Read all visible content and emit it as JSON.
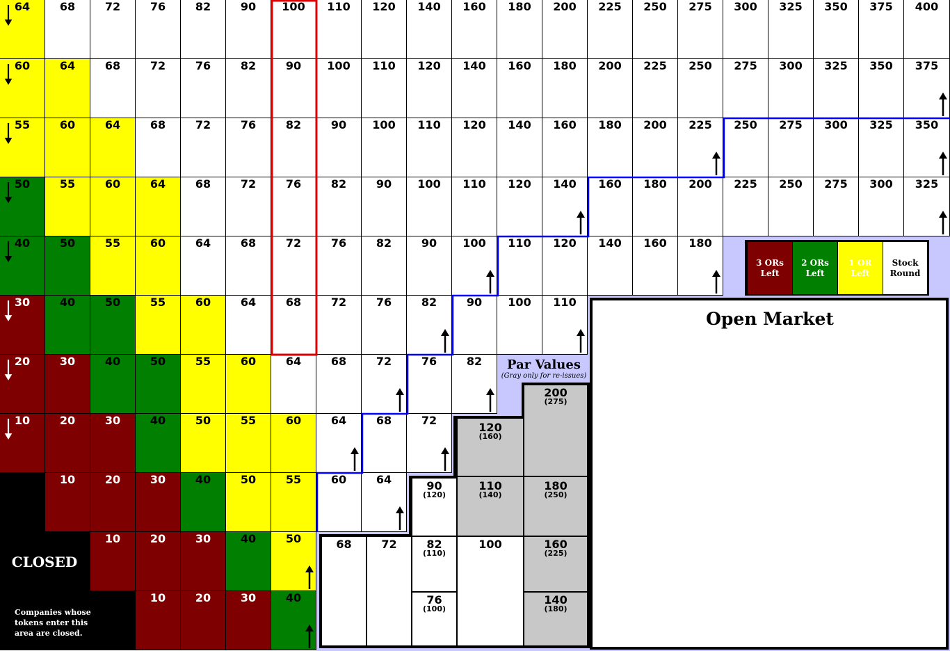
{
  "rows": [
    {
      "values": [
        "64",
        "68",
        "72",
        "76",
        "82",
        "90",
        "100",
        "110",
        "120",
        "140",
        "160",
        "180",
        "200",
        "225",
        "250",
        "275",
        "300",
        "325",
        "350",
        "375",
        "400"
      ],
      "colors": [
        "yellow",
        "white",
        "white",
        "white",
        "white",
        "white",
        "white",
        "white",
        "white",
        "white",
        "white",
        "white",
        "white",
        "white",
        "white",
        "white",
        "white",
        "white",
        "white",
        "white",
        "white"
      ],
      "down_arrow": true,
      "up_arrow_cols": []
    },
    {
      "values": [
        "60",
        "64",
        "68",
        "72",
        "76",
        "82",
        "90",
        "100",
        "110",
        "120",
        "140",
        "160",
        "180",
        "200",
        "225",
        "250",
        "275",
        "300",
        "325",
        "350",
        "375"
      ],
      "colors": [
        "yellow",
        "yellow",
        "white",
        "white",
        "white",
        "white",
        "white",
        "white",
        "white",
        "white",
        "white",
        "white",
        "white",
        "white",
        "white",
        "white",
        "white",
        "white",
        "white",
        "white",
        "white"
      ],
      "down_arrow": true,
      "up_arrow_cols": [
        20
      ]
    },
    {
      "values": [
        "55",
        "60",
        "64",
        "68",
        "72",
        "76",
        "82",
        "90",
        "100",
        "110",
        "120",
        "140",
        "160",
        "180",
        "200",
        "225",
        "250",
        "275",
        "300",
        "325",
        "350"
      ],
      "colors": [
        "yellow",
        "yellow",
        "yellow",
        "white",
        "white",
        "white",
        "white",
        "white",
        "white",
        "white",
        "white",
        "white",
        "white",
        "white",
        "white",
        "white",
        "white",
        "white",
        "white",
        "white",
        "white"
      ],
      "down_arrow": true,
      "up_arrow_cols": [
        15,
        20
      ]
    },
    {
      "values": [
        "50",
        "55",
        "60",
        "64",
        "68",
        "72",
        "76",
        "82",
        "90",
        "100",
        "110",
        "120",
        "140",
        "160",
        "180",
        "200",
        "225",
        "250",
        "275",
        "300",
        "325"
      ],
      "colors": [
        "green",
        "yellow",
        "yellow",
        "yellow",
        "white",
        "white",
        "white",
        "white",
        "white",
        "white",
        "white",
        "white",
        "white",
        "white",
        "white",
        "white",
        "white",
        "white",
        "white",
        "white",
        "white"
      ],
      "down_arrow": true,
      "up_arrow_cols": [
        12,
        20
      ]
    },
    {
      "values": [
        "40",
        "50",
        "55",
        "60",
        "64",
        "68",
        "72",
        "76",
        "82",
        "90",
        "100",
        "110",
        "120",
        "140",
        "160",
        "180"
      ],
      "colors": [
        "green",
        "green",
        "yellow",
        "yellow",
        "white",
        "white",
        "white",
        "white",
        "white",
        "white",
        "white",
        "white",
        "white",
        "white",
        "white",
        "white"
      ],
      "down_arrow": true,
      "up_arrow_cols": [
        10,
        15
      ]
    },
    {
      "values": [
        "30",
        "40",
        "50",
        "55",
        "60",
        "64",
        "68",
        "72",
        "76",
        "82",
        "90",
        "100",
        "110"
      ],
      "colors": [
        "red",
        "green",
        "green",
        "yellow",
        "yellow",
        "white",
        "white",
        "white",
        "white",
        "white",
        "white",
        "white",
        "white"
      ],
      "down_arrow": true,
      "up_arrow_cols": [
        9,
        12
      ]
    },
    {
      "values": [
        "20",
        "30",
        "40",
        "50",
        "55",
        "60",
        "64",
        "68",
        "72",
        "76",
        "82"
      ],
      "colors": [
        "red",
        "red",
        "green",
        "green",
        "yellow",
        "yellow",
        "white",
        "white",
        "white",
        "white",
        "white"
      ],
      "down_arrow": true,
      "up_arrow_cols": [
        8,
        10
      ]
    },
    {
      "values": [
        "10",
        "20",
        "30",
        "40",
        "50",
        "55",
        "60",
        "64",
        "68",
        "72"
      ],
      "colors": [
        "red",
        "red",
        "red",
        "green",
        "yellow",
        "yellow",
        "yellow",
        "white",
        "white",
        "white"
      ],
      "down_arrow": true,
      "up_arrow_cols": [
        7,
        9
      ]
    },
    {
      "values": [
        "",
        "10",
        "20",
        "30",
        "40",
        "50",
        "55",
        "60",
        "64"
      ],
      "colors": [
        "black",
        "red",
        "red",
        "red",
        "green",
        "yellow",
        "yellow",
        "white",
        "white"
      ],
      "down_arrow": false,
      "up_arrow_cols": [
        8
      ]
    },
    {
      "values": [
        "",
        "",
        "10",
        "20",
        "30",
        "40",
        "50"
      ],
      "colors": [
        "black",
        "black",
        "red",
        "red",
        "red",
        "green",
        "yellow"
      ],
      "down_arrow": false,
      "up_arrow_cols": [
        6
      ]
    },
    {
      "values": [
        "",
        "",
        "",
        "10",
        "20",
        "30",
        "40"
      ],
      "colors": [
        "black",
        "black",
        "black",
        "red",
        "red",
        "red",
        "green"
      ],
      "down_arrow": false,
      "up_arrow_cols": [
        6
      ]
    }
  ],
  "closed": {
    "title": "CLOSED",
    "note": "Companies whose tokens enter this area are closed."
  },
  "legend": [
    {
      "label": "3 ORs\nLeft",
      "color": "#7f0000",
      "text_color": "#ffffff"
    },
    {
      "label": "2 ORs\nLeft",
      "color": "#007f00",
      "text_color": "#ffffff"
    },
    {
      "label": "1 OR\nLeft",
      "color": "#ffff00",
      "text_color": "#ffffff"
    },
    {
      "label": "Stock\nRound",
      "color": "#ffffff",
      "text_color": "#000000"
    }
  ],
  "open_market": {
    "title": "Open Market"
  },
  "par_values": {
    "title": "Par Values",
    "subtitle": "(Gray only for re-issues)",
    "slots": [
      {
        "value": "68",
        "reissue": ""
      },
      {
        "value": "72",
        "reissue": ""
      },
      {
        "value": "82",
        "reissue": "(110)"
      },
      {
        "value": "76",
        "reissue": "(100)"
      },
      {
        "value": "100",
        "reissue": ""
      },
      {
        "value": "90",
        "reissue": "(120)"
      },
      {
        "value": "110",
        "reissue": "(140)"
      },
      {
        "value": "120",
        "reissue": "(160)"
      },
      {
        "value": "200",
        "reissue": "(275)"
      },
      {
        "value": "180",
        "reissue": "(250)"
      },
      {
        "value": "160",
        "reissue": "(225)"
      },
      {
        "value": "140",
        "reissue": "(180)"
      }
    ]
  },
  "colors": {
    "red": "#7f0000",
    "green": "#007f00",
    "yellow": "#ffff00",
    "white": "#ffffff",
    "lavender": "#c8c8ff",
    "gray": "#c8c8c8",
    "blue_line": "#0000ff",
    "red_box": "#dd0000"
  },
  "icons": {
    "down": "down-arrow-icon",
    "up": "up-arrow-icon"
  }
}
